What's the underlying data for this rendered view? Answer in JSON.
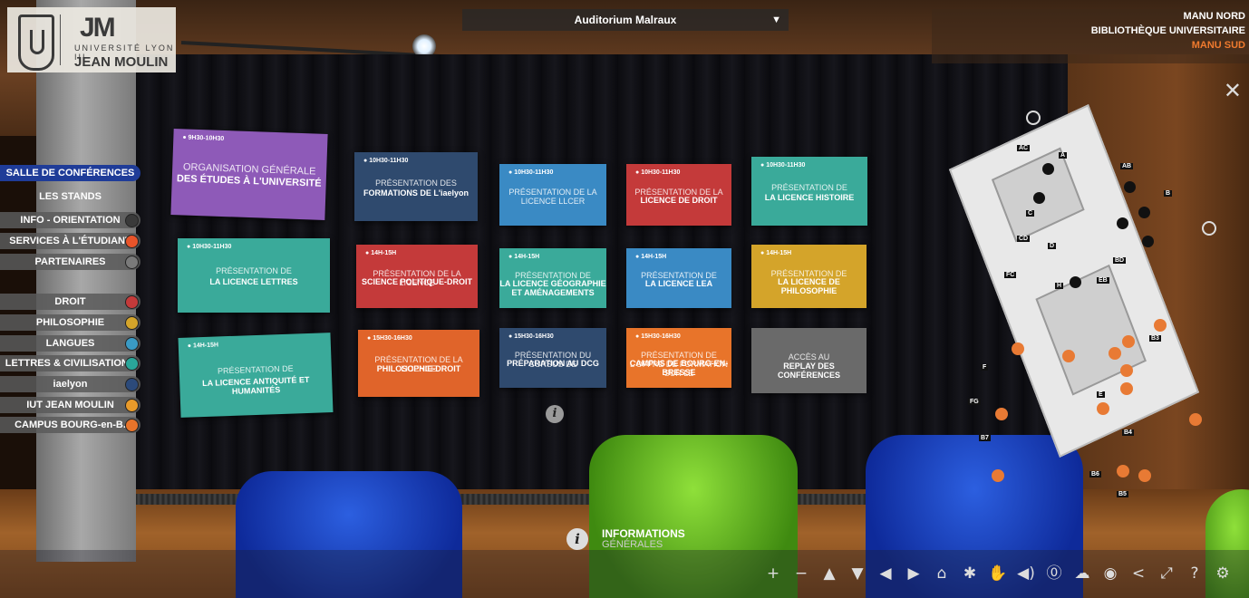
{
  "logo": {
    "univ": "UNIVERSITÉ LYON III",
    "name": "JEAN MOULIN",
    "mark": "JM"
  },
  "room_select": {
    "selected": "Auditorium Malraux"
  },
  "buildings": {
    "nord": "MANU NORD",
    "biblio": "BIBLIOTHÈQUE UNIVERSITAIRE",
    "sud": "MANU SUD"
  },
  "menu": {
    "items": [
      {
        "label": "SALLE DE CONFÉRENCES",
        "selected": true
      },
      {
        "label": "LES STANDS"
      },
      {
        "label": "INFO - ORIENTATION",
        "color": "#3a3a3a"
      },
      {
        "label": "SERVICES À L'ÉTUDIANT",
        "color": "#e8542a"
      },
      {
        "label": "PARTENAIRES",
        "color": "#7a7a7a"
      },
      {
        "label": "DROIT",
        "color": "#c43a3a"
      },
      {
        "label": "PHILOSOPHIE",
        "color": "#d4a42a"
      },
      {
        "label": "LANGUES",
        "color": "#3a9ac4"
      },
      {
        "label": "LETTRES & CIVILISATIONS",
        "color": "#2aa69a"
      },
      {
        "label": "iaelyon",
        "color": "#2c4a7a"
      },
      {
        "label": "IUT JEAN MOULIN",
        "color": "#e89a2a"
      },
      {
        "label": "CAMPUS BOURG-en-B.",
        "color": "#e8742a"
      }
    ]
  },
  "panels": [
    {
      "time": "9H30-10H30",
      "l1": "ORGANISATION GÉNÉRALE",
      "l2": "DES ÉTUDES À L'UNIVERSITÉ",
      "l3": "",
      "color": "#8e5ab8"
    },
    {
      "time": "10H30-11H30",
      "l1": "PRÉSENTATION DES",
      "l2": "FORMATIONS DE L'iaelyon",
      "l3": "",
      "color": "#2f4a6e"
    },
    {
      "time": "10H30-11H30",
      "l1": "PRÉSENTATION DE LA LICENCE LLCER",
      "l2": "",
      "l3": "",
      "color": "#3a8ac4"
    },
    {
      "time": "10H30-11H30",
      "l1": "PRÉSENTATION DE LA",
      "l2": "LICENCE DE DROIT",
      "l3": "",
      "color": "#c43a3a"
    },
    {
      "time": "10H30-11H30",
      "l1": "PRÉSENTATION DE",
      "l2": "LA LICENCE HISTOIRE",
      "l3": "",
      "color": "#3aaa9a"
    },
    {
      "time": "10H30-11H30",
      "l1": "PRÉSENTATION DE",
      "l2": "LA LICENCE LETTRES",
      "l3": "",
      "color": "#3aaa9a"
    },
    {
      "time": "14H-15H",
      "l1": "PRÉSENTATION DE LA LICENCE",
      "l2": "SCIENCE POLITIQUE-DROIT",
      "l3": "",
      "color": "#c43a3a"
    },
    {
      "time": "14H-15H",
      "l1": "PRÉSENTATION DE",
      "l2": "LA LICENCE GÉOGRAPHIE ET AMÉNAGEMENTS",
      "l3": "",
      "color": "#3aaa9a"
    },
    {
      "time": "14H-15H",
      "l1": "PRÉSENTATION DE",
      "l2": "LA LICENCE LEA",
      "l3": "",
      "color": "#3a8ac4"
    },
    {
      "time": "14H-15H",
      "l1": "PRÉSENTATION DE",
      "l2": "LA LICENCE DE PHILOSOPHIE",
      "l3": "",
      "color": "#d4a42a"
    },
    {
      "time": "14H-15H",
      "l1": "PRÉSENTATION DE",
      "l2": "LA LICENCE ANTIQUITÉ ET HUMANITÉS",
      "l3": "",
      "color": "#3aaa9a"
    },
    {
      "time": "15H30-16H30",
      "l1": "PRÉSENTATION DE LA LICENCE",
      "l2": "PHILOSOPHIE-DROIT",
      "l3": "",
      "color": "#e0642a"
    },
    {
      "time": "15H30-16H30",
      "l1": "PRÉSENTATION DU CURSUS DE",
      "l2": "PRÉPARATION AU DCG",
      "l3": "",
      "color": "#2f4a6e"
    },
    {
      "time": "15H30-16H30",
      "l1": "PRÉSENTATION DE L'OFFRE DE FORMATION SUR LE",
      "l2": "CAMPUS DE BOURG-EN-BRESSE",
      "l3": "",
      "color": "#e8742a"
    },
    {
      "time": "",
      "l1": "ACCÈS AU",
      "l2": "REPLAY DES CONFÉRENCES",
      "l3": "",
      "color": "#6a6a6a"
    }
  ],
  "plan_labels": [
    "AC",
    "A",
    "AB",
    "B",
    "C",
    "CD",
    "D",
    "BD",
    "FC",
    "H",
    "EB",
    "B3",
    "F",
    "FG",
    "E",
    "B7",
    "B4",
    "B6",
    "B5"
  ],
  "info": {
    "l1": "INFORMATIONS",
    "l2": "GÉNÉRALES"
  },
  "toolbar_glyphs": [
    "+",
    "−",
    "▲",
    "▼",
    "◀",
    "▶",
    "⌂",
    "✱",
    "✋",
    "◀)",
    "⓪",
    "☁",
    "◉",
    "<",
    "⤢",
    "?",
    "⚙"
  ]
}
